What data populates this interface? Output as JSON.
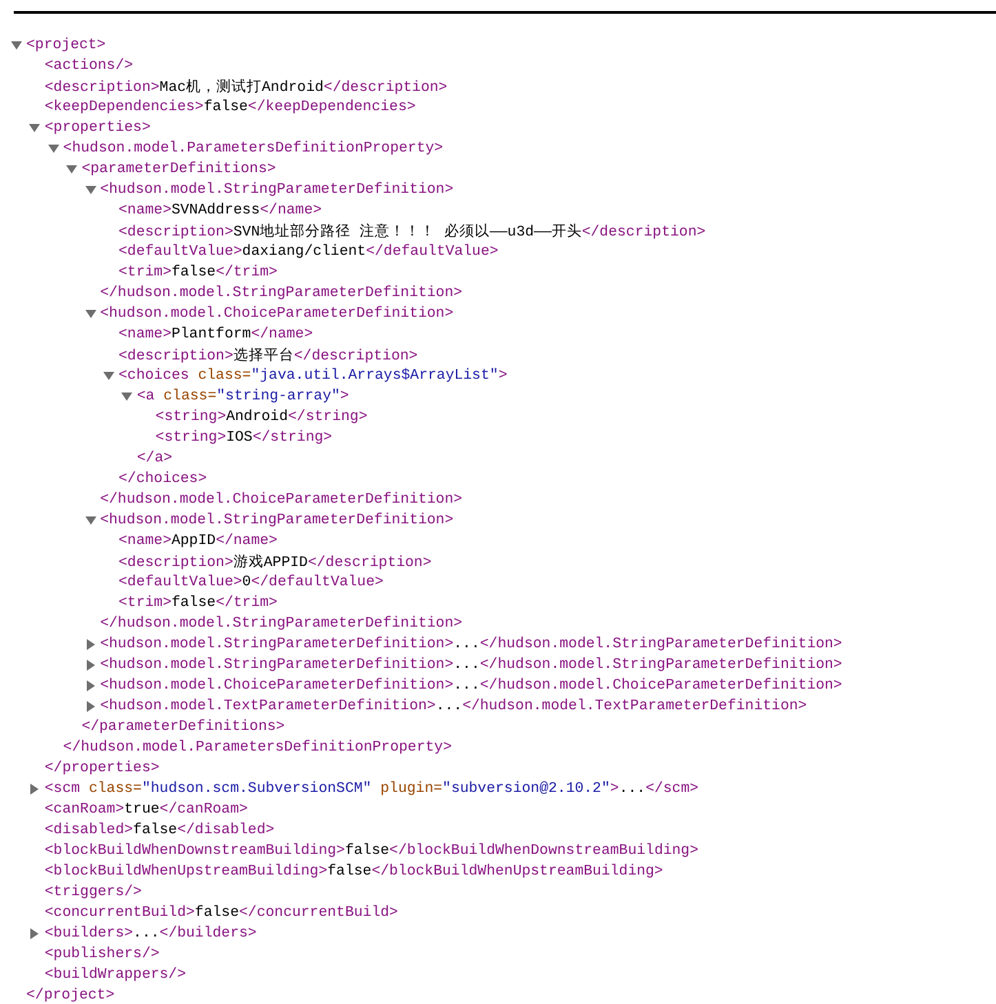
{
  "document": {
    "open": "<project>",
    "expanded": true,
    "close": "</project>",
    "children": [
      {
        "line": "<actions/>"
      },
      {
        "open": "<description>",
        "text": "Mac机，测试打Android",
        "close": "</description>"
      },
      {
        "open": "<keepDependencies>",
        "text": "false",
        "close": "</keepDependencies>"
      },
      {
        "open": "<properties>",
        "expanded": true,
        "close": "</properties>",
        "children": [
          {
            "open": "<hudson.model.ParametersDefinitionProperty>",
            "expanded": true,
            "close": "</hudson.model.ParametersDefinitionProperty>",
            "children": [
              {
                "open": "<parameterDefinitions>",
                "expanded": true,
                "close": "</parameterDefinitions>",
                "children": [
                  {
                    "open": "<hudson.model.StringParameterDefinition>",
                    "expanded": true,
                    "close": "</hudson.model.StringParameterDefinition>",
                    "children": [
                      {
                        "open": "<name>",
                        "text": "SVNAddress",
                        "close": "</name>"
                      },
                      {
                        "open": "<description>",
                        "text": "SVN地址部分路径 注意！！！ 必须以——u3d——开头",
                        "close": "</description>"
                      },
                      {
                        "open": "<defaultValue>",
                        "text": "daxiang/client",
                        "close": "</defaultValue>"
                      },
                      {
                        "open": "<trim>",
                        "text": "false",
                        "close": "</trim>"
                      }
                    ]
                  },
                  {
                    "open": "<hudson.model.ChoiceParameterDefinition>",
                    "expanded": true,
                    "close": "</hudson.model.ChoiceParameterDefinition>",
                    "children": [
                      {
                        "open": "<name>",
                        "text": "Plantform",
                        "close": "</name>"
                      },
                      {
                        "open": "<description>",
                        "text": "选择平台",
                        "close": "</description>"
                      },
                      {
                        "open": [
                          {
                            "kind": "tag",
                            "text": "<choices "
                          },
                          {
                            "kind": "attr",
                            "text": "class="
                          },
                          {
                            "kind": "value",
                            "text": "\"java.util.Arrays$ArrayList\""
                          },
                          {
                            "kind": "tag",
                            "text": ">"
                          }
                        ],
                        "expanded": true,
                        "close": "</choices>",
                        "children": [
                          {
                            "open": [
                              {
                                "kind": "tag",
                                "text": "<a "
                              },
                              {
                                "kind": "attr",
                                "text": "class="
                              },
                              {
                                "kind": "value",
                                "text": "\"string-array\""
                              },
                              {
                                "kind": "tag",
                                "text": ">"
                              }
                            ],
                            "expanded": true,
                            "close": "</a>",
                            "children": [
                              {
                                "open": "<string>",
                                "text": "Android",
                                "close": "</string>"
                              },
                              {
                                "open": "<string>",
                                "text": "IOS",
                                "close": "</string>"
                              }
                            ]
                          }
                        ]
                      }
                    ]
                  },
                  {
                    "open": "<hudson.model.StringParameterDefinition>",
                    "expanded": true,
                    "close": "</hudson.model.StringParameterDefinition>",
                    "children": [
                      {
                        "open": "<name>",
                        "text": "AppID",
                        "close": "</name>"
                      },
                      {
                        "open": "<description>",
                        "text": "游戏APPID",
                        "close": "</description>"
                      },
                      {
                        "open": "<defaultValue>",
                        "text": "0",
                        "close": "</defaultValue>"
                      },
                      {
                        "open": "<trim>",
                        "text": "false",
                        "close": "</trim>"
                      }
                    ]
                  },
                  {
                    "open": "<hudson.model.StringParameterDefinition>",
                    "expanded": false,
                    "text": "...",
                    "close": "</hudson.model.StringParameterDefinition>"
                  },
                  {
                    "open": "<hudson.model.StringParameterDefinition>",
                    "expanded": false,
                    "text": "...",
                    "close": "</hudson.model.StringParameterDefinition>"
                  },
                  {
                    "open": "<hudson.model.ChoiceParameterDefinition>",
                    "expanded": false,
                    "text": "...",
                    "close": "</hudson.model.ChoiceParameterDefinition>"
                  },
                  {
                    "open": "<hudson.model.TextParameterDefinition>",
                    "expanded": false,
                    "text": "...",
                    "close": "</hudson.model.TextParameterDefinition>"
                  }
                ]
              }
            ]
          }
        ]
      },
      {
        "open": [
          {
            "kind": "tag",
            "text": "<scm "
          },
          {
            "kind": "attr",
            "text": "class="
          },
          {
            "kind": "value",
            "text": "\"hudson.scm.SubversionSCM\""
          },
          {
            "kind": "attr",
            "text": " plugin="
          },
          {
            "kind": "value",
            "text": "\"subversion@2.10.2\""
          },
          {
            "kind": "tag",
            "text": ">"
          }
        ],
        "expanded": false,
        "text": "...",
        "close": "</scm>"
      },
      {
        "open": "<canRoam>",
        "text": "true",
        "close": "</canRoam>"
      },
      {
        "open": "<disabled>",
        "text": "false",
        "close": "</disabled>"
      },
      {
        "open": "<blockBuildWhenDownstreamBuilding>",
        "text": "false",
        "close": "</blockBuildWhenDownstreamBuilding>"
      },
      {
        "open": "<blockBuildWhenUpstreamBuilding>",
        "text": "false",
        "close": "</blockBuildWhenUpstreamBuilding>"
      },
      {
        "line": "<triggers/>"
      },
      {
        "open": "<concurrentBuild>",
        "text": "false",
        "close": "</concurrentBuild>"
      },
      {
        "open": "<builders>",
        "expanded": false,
        "text": "...",
        "close": "</builders>"
      },
      {
        "line": "<publishers/>"
      },
      {
        "line": "<buildWrappers/>"
      }
    ]
  }
}
